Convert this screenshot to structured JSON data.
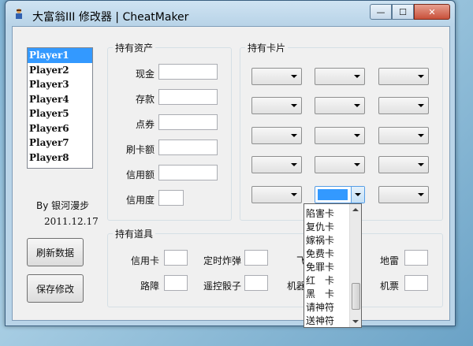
{
  "window": {
    "title": "大富翁III 修改器 | CheatMaker",
    "minimize": "—",
    "maximize": "☐",
    "close": "✕"
  },
  "players": [
    "Player1",
    "Player2",
    "Player3",
    "Player4",
    "Player5",
    "Player6",
    "Player7",
    "Player8"
  ],
  "selected_player": "Player1",
  "credits": {
    "author": "By 银河漫步",
    "date": "2011.12.17"
  },
  "buttons": {
    "refresh": "刷新数据",
    "save": "保存修改"
  },
  "assets": {
    "title": "持有资产",
    "labels": [
      "现金",
      "存款",
      "点券",
      "刷卡额",
      "信用额",
      "信用度"
    ]
  },
  "cards": {
    "title": "持有卡片"
  },
  "items": {
    "title": "持有道具",
    "labels": [
      "信用卡",
      "定时炸弹",
      "飞弹",
      "地雷",
      "路障",
      "遥控骰子",
      "机器娃娃",
      "机票"
    ]
  },
  "dropdown": {
    "options": [
      "陷害卡",
      "复仇卡",
      "嫁祸卡",
      "免费卡",
      "免罪卡",
      "红　卡",
      "黑　卡",
      "请神符",
      "送神符"
    ]
  }
}
